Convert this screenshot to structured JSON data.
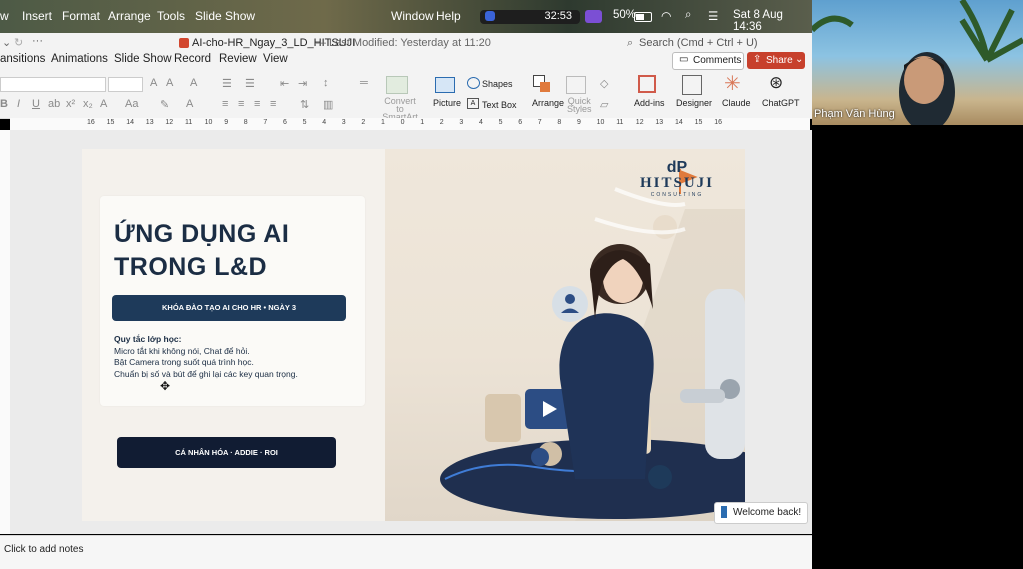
{
  "menubar": {
    "items": [
      "w",
      "Insert",
      "Format",
      "Arrange",
      "Tools",
      "Slide Show",
      "Window",
      "Help"
    ],
    "timer": "32:53",
    "battery": "50%",
    "datetime": "Sat 8 Aug  14:36"
  },
  "window": {
    "doc_title": "AI-cho-HR_Ngay_3_LD_HITSUJI",
    "modified": "— Last Modified: Yesterday at 11:20",
    "search_placeholder": "Search (Cmd + Ctrl + U)"
  },
  "ribbon_tabs": [
    "ansitions",
    "Animations",
    "Slide Show",
    "Record",
    "Review",
    "View"
  ],
  "ribbon_buttons": {
    "comments": "Comments",
    "share": "Share",
    "shapes": "Shapes",
    "text_box": "Text Box",
    "picture": "Picture",
    "arrange": "Arrange",
    "quick_styles_1": "Quick",
    "quick_styles_2": "Styles",
    "convert_1": "Convert to",
    "convert_2": "SmartArt",
    "addins": "Add-ins",
    "designer": "Designer",
    "claude": "Claude",
    "chatgpt": "ChatGPT",
    "aa": "Aa"
  },
  "ruler_labels": [
    "16",
    "15",
    "14",
    "13",
    "12",
    "11",
    "10",
    "9",
    "8",
    "7",
    "6",
    "5",
    "4",
    "3",
    "2",
    "1",
    "0",
    "1",
    "2",
    "3",
    "4",
    "5",
    "6",
    "7",
    "8",
    "9",
    "10",
    "11",
    "12",
    "13",
    "14",
    "15",
    "16"
  ],
  "slide": {
    "title_line1": "ỨNG DỤNG AI",
    "title_line2": "TRONG L&D",
    "pill1": "KHÓA ĐÀO TẠO AI CHO HR • NGÀY 3",
    "rules_heading": "Quy tắc lớp học:",
    "rules": [
      "Micro tắt khi không nói, Chat để hỏi.",
      "Bật Camera trong suốt quá trình học.",
      "Chuẩn bị số và bút để ghi lại các key quan trọng."
    ],
    "pill2": "CÁ NHÂN HÓA · ADDIE · ROI",
    "logo_name": "HITSUJI",
    "logo_sub": "CONSULTING"
  },
  "notes_placeholder": "Click to add notes",
  "participant_name": "Phạm Văn Hùng",
  "welcome_toast": "Welcome back!",
  "colors": {
    "share": "#c7402c",
    "navy": "#1e3a5a",
    "dark_navy": "#111c33",
    "accent_orange": "#e07a3c"
  }
}
